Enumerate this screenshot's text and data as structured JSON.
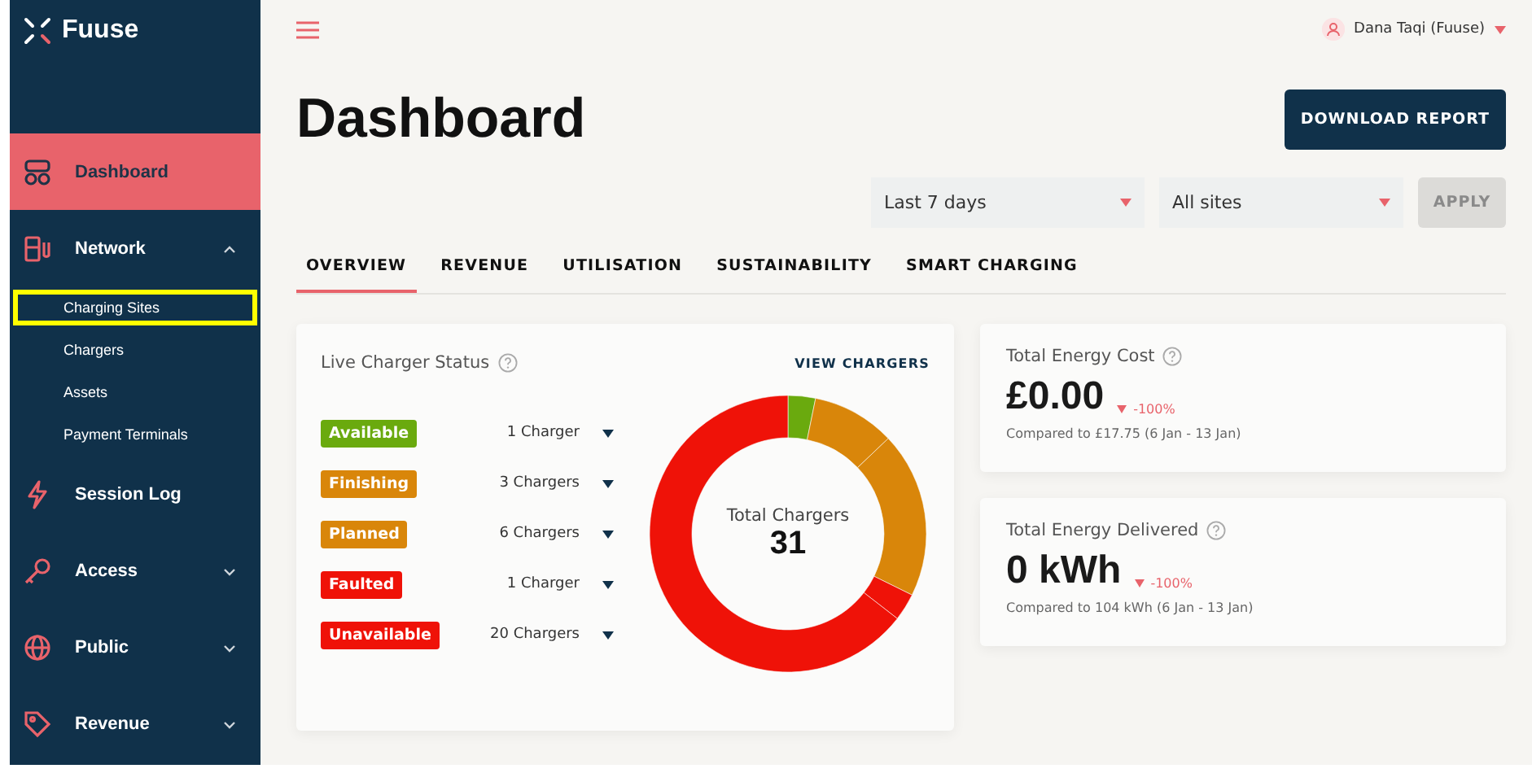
{
  "sidebar": {
    "logo": "Fuuse",
    "items": [
      {
        "label": "Dashboard",
        "kind": "link",
        "selected": true
      },
      {
        "label": "Network",
        "kind": "group",
        "selected": false,
        "expanded": true,
        "children": [
          {
            "label": "Charging Sites",
            "highlighted": true
          },
          {
            "label": "Chargers",
            "highlighted": false
          },
          {
            "label": "Assets",
            "highlighted": false
          },
          {
            "label": "Payment Terminals",
            "highlighted": false
          }
        ]
      },
      {
        "label": "Session Log",
        "kind": "link",
        "selected": false
      },
      {
        "label": "Access",
        "kind": "group",
        "selected": false,
        "expanded": false
      },
      {
        "label": "Public",
        "kind": "group",
        "selected": false,
        "expanded": false
      },
      {
        "label": "Revenue",
        "kind": "group",
        "selected": false,
        "expanded": false
      }
    ]
  },
  "user": {
    "name": "Dana Taqi (Fuuse)"
  },
  "title": "Dashboard",
  "download_button": "DOWNLOAD REPORT",
  "filters": [
    {
      "value": "Last 7 days"
    },
    {
      "value": "All sites"
    }
  ],
  "apply_button": {
    "label": "APPLY",
    "disabled": true
  },
  "tabs": [
    {
      "label": "OVERVIEW",
      "selected": true
    },
    {
      "label": "REVENUE",
      "selected": false
    },
    {
      "label": "UTILISATION",
      "selected": false
    },
    {
      "label": "SUSTAINABILITY",
      "selected": false
    },
    {
      "label": "SMART CHARGING",
      "selected": false
    }
  ],
  "status_card": {
    "title": "Live Charger Status",
    "link": "VIEW CHARGERS",
    "statuses": [
      {
        "count": "1 Charger",
        "color": "#6aaa0e"
      },
      {
        "count": "3 Chargers",
        "color": "#d9860a"
      },
      {
        "count": "6 Chargers",
        "color": "#d9860a"
      },
      {
        "count": "1 Charger",
        "color": "#ef1208"
      },
      {
        "count": "20 Chargers",
        "color": "#ef1208"
      }
    ],
    "total_label": "Total Chargers",
    "total": "31",
    "chart_data": {
      "type": "donut",
      "categories": [
        "Available",
        "Finishing",
        "Planned",
        "Faulted",
        "Unavailable"
      ],
      "values": [
        3.2,
        9.7,
        19.4,
        3.2,
        64.5
      ]
    }
  },
  "metrics": [
    {
      "title": "Total Energy Cost",
      "value": "£0.00",
      "change": "-100%",
      "comparison": "Compared to £17.75 (6 Jan - 13 Jan)"
    },
    {
      "title": "Total Energy Delivered",
      "value": "0 kWh",
      "change": "-100%",
      "comparison": "Compared to 104 kWh (6 Jan - 13 Jan)"
    }
  ]
}
